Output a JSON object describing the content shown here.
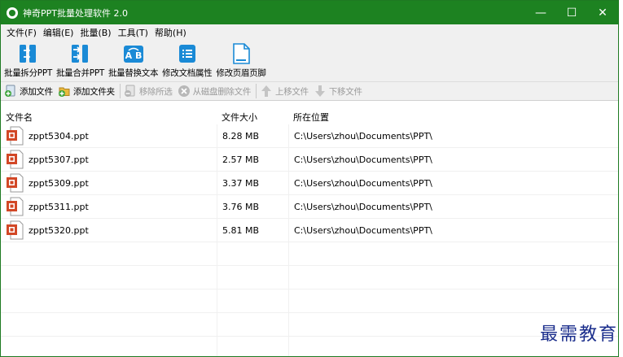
{
  "window": {
    "title": "神奇PPT批量处理软件 2.0",
    "controls": {
      "minimize": "—",
      "maximize": "☐",
      "close": "✕"
    }
  },
  "menu": [
    "文件(F)",
    "编辑(E)",
    "批量(B)",
    "工具(T)",
    "帮助(H)"
  ],
  "toolbar": [
    {
      "label": "批量拆分PPT",
      "icon": "split-icon"
    },
    {
      "label": "批量合并PPT",
      "icon": "merge-icon"
    },
    {
      "label": "批量替换文本",
      "icon": "replace-text-icon"
    },
    {
      "label": "修改文档属性",
      "icon": "doc-properties-icon"
    },
    {
      "label": "修改页眉页脚",
      "icon": "header-footer-icon"
    }
  ],
  "actions": {
    "add_file": "添加文件",
    "add_folder": "添加文件夹",
    "remove_selected": "移除所选",
    "delete_from_disk": "从磁盘删除文件",
    "move_up": "上移文件",
    "move_down": "下移文件"
  },
  "table": {
    "headers": [
      "文件名",
      "文件大小",
      "所在位置"
    ],
    "rows": [
      {
        "name": "zppt5304.ppt",
        "size": "8.28 MB",
        "path": "C:\\Users\\zhou\\Documents\\PPT\\"
      },
      {
        "name": "zppt5307.ppt",
        "size": "2.57 MB",
        "path": "C:\\Users\\zhou\\Documents\\PPT\\"
      },
      {
        "name": "zppt5309.ppt",
        "size": "3.37 MB",
        "path": "C:\\Users\\zhou\\Documents\\PPT\\"
      },
      {
        "name": "zppt5311.ppt",
        "size": "3.76 MB",
        "path": "C:\\Users\\zhou\\Documents\\PPT\\"
      },
      {
        "name": "zppt5320.ppt",
        "size": "5.81 MB",
        "path": "C:\\Users\\zhou\\Documents\\PPT\\"
      }
    ]
  },
  "watermark": "最需教育",
  "colors": {
    "titlebar": "#1d8221",
    "toolbar_icon": "#1a8ad6",
    "ppt_red": "#d24726",
    "watermark": "#1b2e8c"
  }
}
